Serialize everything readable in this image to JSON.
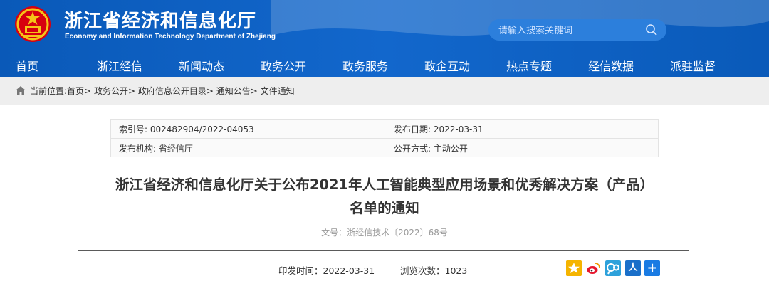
{
  "site": {
    "title_cn": "浙江省经济和信息化厅",
    "title_en": "Economy and Information Technology Department of Zhejiang"
  },
  "search": {
    "placeholder": "请输入搜索关键词"
  },
  "nav": {
    "items": [
      {
        "label": "首页",
        "active": true
      },
      {
        "label": "浙江经信"
      },
      {
        "label": "新闻动态"
      },
      {
        "label": "政务公开"
      },
      {
        "label": "政务服务"
      },
      {
        "label": "政企互动"
      },
      {
        "label": "热点专题"
      },
      {
        "label": "经信数据"
      },
      {
        "label": "派驻监督"
      }
    ]
  },
  "breadcrumb": {
    "prefix": "当前位置:",
    "items": [
      "首页",
      "政务公开",
      "政府信息公开目录",
      "通知公告",
      "文件通知"
    ],
    "separator": ">"
  },
  "meta": {
    "index_no": "索引号: 002482904/2022-04053",
    "publish_date": "发布日期: 2022-03-31",
    "issuer": "发布机构: 省经信厅",
    "disclosure": "公开方式: 主动公开"
  },
  "document": {
    "title_line1": "浙江省经济和信息化厅关于公布2021年人工智能典型应用场景和优秀解决方案（产品）",
    "title_line2": "名单的通知",
    "number": "文号：浙经信技术〔2022〕68号",
    "print_time": "印发时间：2022-03-31",
    "views": "浏览次数：1023"
  },
  "colors": {
    "header_blue": "#0d5fbf",
    "accent": "#2c7fdc"
  },
  "share": {
    "icons": [
      "qzone-icon",
      "weibo-icon",
      "tencent-weibo-icon",
      "renren-icon",
      "more-share-icon"
    ],
    "renren_glyph": "人",
    "more_glyph": "+"
  }
}
